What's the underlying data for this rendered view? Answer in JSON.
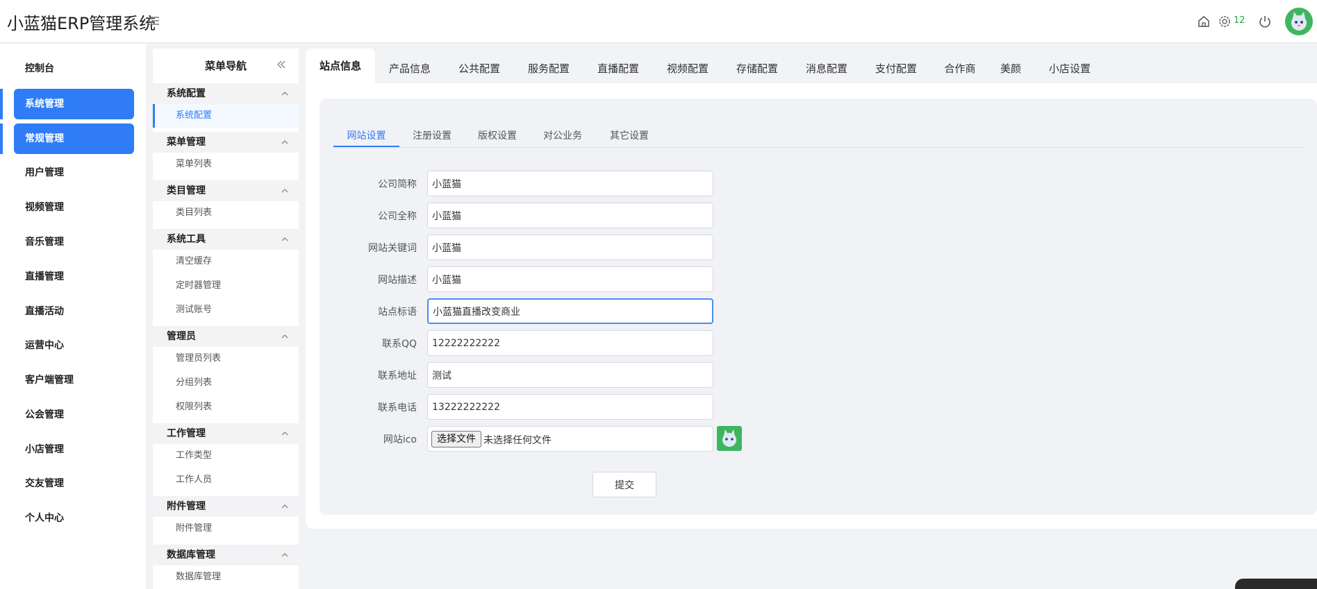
{
  "header": {
    "title": "小蓝猫ERP管理系统",
    "badge_count": "12",
    "icons": [
      "list-icon",
      "home-icon",
      "gear-icon",
      "power-icon"
    ]
  },
  "sidebar": {
    "items": [
      {
        "label": "控制台",
        "active": false
      },
      {
        "label": "系统管理",
        "active": true
      },
      {
        "label": "常规管理",
        "active": true
      },
      {
        "label": "用户管理",
        "active": false
      },
      {
        "label": "视频管理",
        "active": false
      },
      {
        "label": "音乐管理",
        "active": false
      },
      {
        "label": "直播管理",
        "active": false
      },
      {
        "label": "直播活动",
        "active": false
      },
      {
        "label": "运营中心",
        "active": false
      },
      {
        "label": "客户端管理",
        "active": false
      },
      {
        "label": "公会管理",
        "active": false
      },
      {
        "label": "小店管理",
        "active": false
      },
      {
        "label": "交友管理",
        "active": false
      },
      {
        "label": "个人中心",
        "active": false
      }
    ]
  },
  "subnav": {
    "title": "菜单导航",
    "groups": [
      {
        "label": "系统配置",
        "children": [
          "系统配置"
        ]
      },
      {
        "label": "菜单管理",
        "children": [
          "菜单列表"
        ]
      },
      {
        "label": "类目管理",
        "children": [
          "类目列表"
        ]
      },
      {
        "label": "系统工具",
        "children": [
          "清空缓存",
          "定时器管理",
          "测试账号"
        ]
      },
      {
        "label": "管理员",
        "children": [
          "管理员列表",
          "分组列表",
          "权限列表"
        ]
      },
      {
        "label": "工作管理",
        "children": [
          "工作类型",
          "工作人员"
        ]
      },
      {
        "label": "附件管理",
        "children": [
          "附件管理"
        ]
      },
      {
        "label": "数据库管理",
        "children": [
          "数据库管理"
        ]
      }
    ]
  },
  "tabs": [
    "站点信息",
    "产品信息",
    "公共配置",
    "服务配置",
    "直播配置",
    "视频配置",
    "存储配置",
    "消息配置",
    "支付配置",
    "合作商",
    "美颜",
    "小店设置"
  ],
  "active_tab": "站点信息",
  "subtabs": [
    "网站设置",
    "注册设置",
    "版权设置",
    "对公业务",
    "其它设置"
  ],
  "active_subtab": "网站设置",
  "form": {
    "fields": [
      {
        "label": "公司简称",
        "value": "小蓝猫"
      },
      {
        "label": "公司全称",
        "value": "小蓝猫"
      },
      {
        "label": "网站关键词",
        "value": "小蓝猫"
      },
      {
        "label": "网站描述",
        "value": "小蓝猫"
      },
      {
        "label": "站点标语",
        "value": "小蓝猫直播改变商业"
      },
      {
        "label": "联系QQ",
        "value": "12222222222"
      },
      {
        "label": "联系地址",
        "value": "测试"
      },
      {
        "label": "联系电话",
        "value": "13222222222"
      }
    ],
    "file_label": "网站ico",
    "file_button": "选择文件",
    "file_status": "未选择任何文件",
    "submit": "提交"
  },
  "colors": {
    "accent": "#2f7cf6",
    "avatar_bg": "#3fb560",
    "badge": "#28a745"
  }
}
